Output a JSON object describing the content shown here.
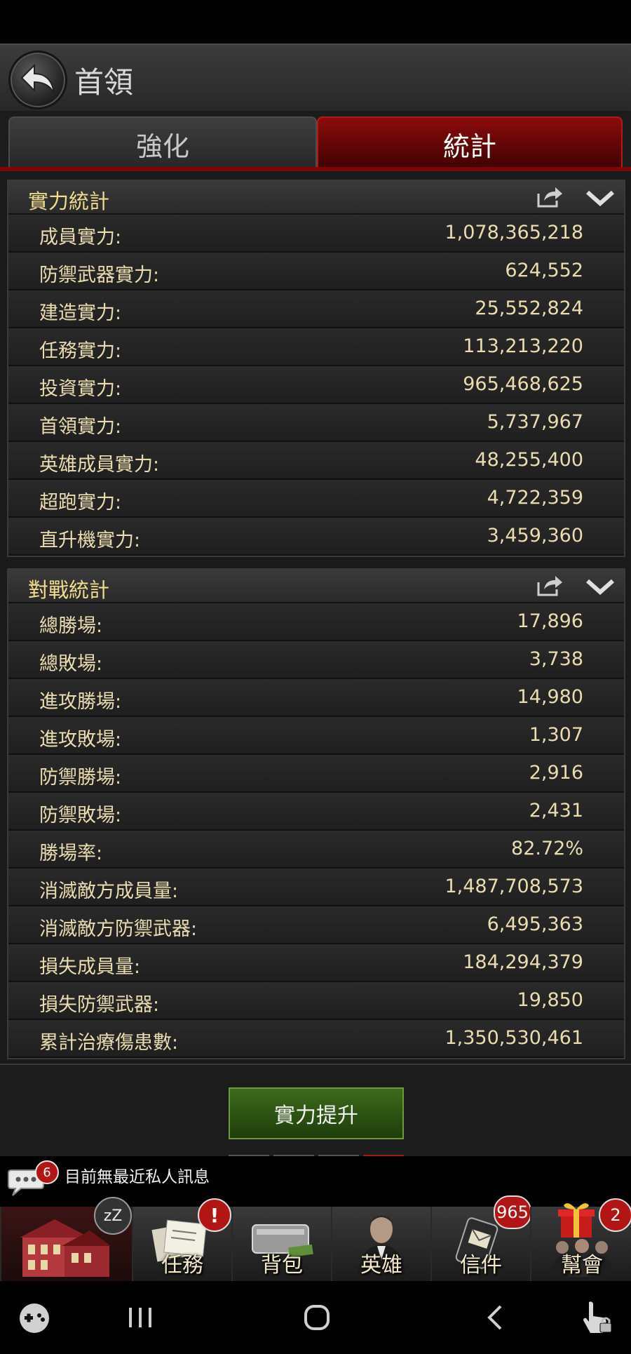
{
  "header": {
    "title": "首領"
  },
  "tabs": [
    {
      "label": "強化",
      "active": false
    },
    {
      "label": "統計",
      "active": true
    }
  ],
  "power_stats": {
    "title": "實力統計",
    "rows": [
      {
        "label": "成員實力:",
        "value": "1,078,365,218"
      },
      {
        "label": "防禦武器實力:",
        "value": "624,552"
      },
      {
        "label": "建造實力:",
        "value": "25,552,824"
      },
      {
        "label": "任務實力:",
        "value": "113,213,220"
      },
      {
        "label": "投資實力:",
        "value": "965,468,625"
      },
      {
        "label": "首領實力:",
        "value": "5,737,967"
      },
      {
        "label": "英雄成員實力:",
        "value": "48,255,400"
      },
      {
        "label": "超跑實力:",
        "value": "4,722,359"
      },
      {
        "label": "直升機實力:",
        "value": "3,459,360"
      }
    ]
  },
  "battle_stats": {
    "title": "對戰統計",
    "rows": [
      {
        "label": "總勝場:",
        "value": "17,896"
      },
      {
        "label": "總敗場:",
        "value": "3,738"
      },
      {
        "label": "進攻勝場:",
        "value": "14,980"
      },
      {
        "label": "進攻敗場:",
        "value": "1,307"
      },
      {
        "label": "防禦勝場:",
        "value": "2,916"
      },
      {
        "label": "防禦敗場:",
        "value": "2,431"
      },
      {
        "label": "勝場率:",
        "value": "82.72%"
      },
      {
        "label": "消滅敵方成員量:",
        "value": "1,487,708,573"
      },
      {
        "label": "消滅敵方防禦武器:",
        "value": "6,495,363"
      },
      {
        "label": "損失成員量:",
        "value": "184,294,379"
      },
      {
        "label": "損失防禦武器:",
        "value": "19,850"
      },
      {
        "label": "累計治療傷患數:",
        "value": "1,350,530,461"
      }
    ]
  },
  "footer": {
    "upgrade_label": "實力提升"
  },
  "messages": {
    "badge": "6",
    "text": "目前無最近私人訊息"
  },
  "nav": {
    "tasks": "任務",
    "bag": "背包",
    "heroes": "英雄",
    "mail": "信件",
    "mail_badge": "965",
    "guild": "幫會",
    "guild_badge": "2",
    "alert_badge": "!",
    "sleep_badge": "zZ"
  },
  "colors": {
    "accent_red": "#8c0b0b",
    "gold_text": "#f1dc8e",
    "button_green": "#3d6a1b"
  }
}
